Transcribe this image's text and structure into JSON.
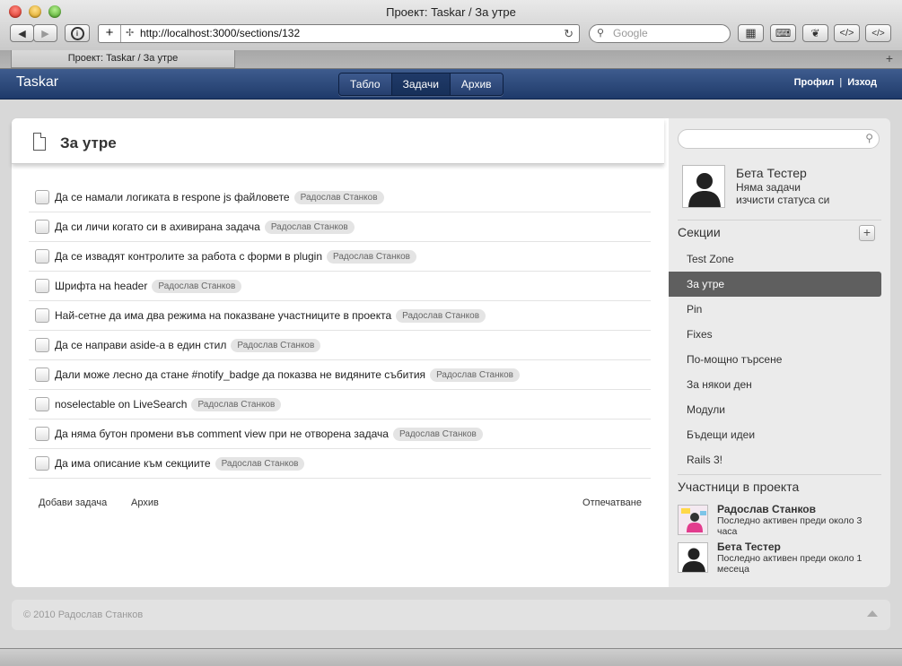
{
  "browser": {
    "window_title": "Проект: Taskar / За утре",
    "url": "http://localhost:3000/sections/132",
    "search_placeholder": "Google",
    "tab_title": "Проект: Taskar / За утре"
  },
  "navbar": {
    "brand": "Taskar",
    "nav": [
      "Табло",
      "Задачи",
      "Архив"
    ],
    "active_nav": "Задачи",
    "profile": "Профил",
    "separator": "|",
    "logout": "Изход"
  },
  "main": {
    "title": "За утре",
    "tasks": [
      {
        "text": "Да се намали логиката в respone js файловете",
        "owner": "Радослав Станков"
      },
      {
        "text": "Да си личи когато си в ахивирана задача",
        "owner": "Радослав Станков"
      },
      {
        "text": "Да се извадят контролите за работа с форми в plugin",
        "owner": "Радослав Станков"
      },
      {
        "text": "Шрифта на header",
        "owner": "Радослав Станков"
      },
      {
        "text": "Най-сетне да има два режима на показване участниците в проекта",
        "owner": "Радослав Станков"
      },
      {
        "text": "Да се направи aside-а в един стил",
        "owner": "Радослав Станков"
      },
      {
        "text": "Дали може лесно да стане #notify_badge да показва не видяните събития",
        "owner": "Радослав Станков"
      },
      {
        "text": "noselectable on LiveSearch",
        "owner": "Радослав Станков"
      },
      {
        "text": "Да няма бутон промени във comment view при не отворена задача",
        "owner": "Радослав Станков"
      },
      {
        "text": "Да има описание към секциите",
        "owner": "Радослав Станков"
      }
    ],
    "add_task": "Добави задача",
    "archive": "Архив",
    "print": "Отпечатване"
  },
  "sidebar": {
    "current_user": {
      "name": "Бета Тестер",
      "status": "Няма задачи",
      "clear_status": "изчисти статуса си"
    },
    "sections_heading": "Секции",
    "add_section": "+",
    "sections": [
      "Test Zone",
      "За утре",
      "Pin",
      "Fixes",
      "По-мощно търсене",
      "За някои ден",
      "Модули",
      "Бъдещи идеи",
      "Rails 3!"
    ],
    "active_section": "За утре",
    "members_heading": "Участници в проекта",
    "members": [
      {
        "name": "Радослав Станков",
        "status": "Последно активен преди около 3 часа"
      },
      {
        "name": "Бета Тестер",
        "status": "Последно активен преди около 1 месеца"
      }
    ]
  },
  "footer": {
    "copyright": "© 2010 Радослав Станков"
  },
  "colors": {
    "navbar": "#2a4677",
    "active_section": "#5f5f5f",
    "tag_bg": "#e4e4e4"
  }
}
